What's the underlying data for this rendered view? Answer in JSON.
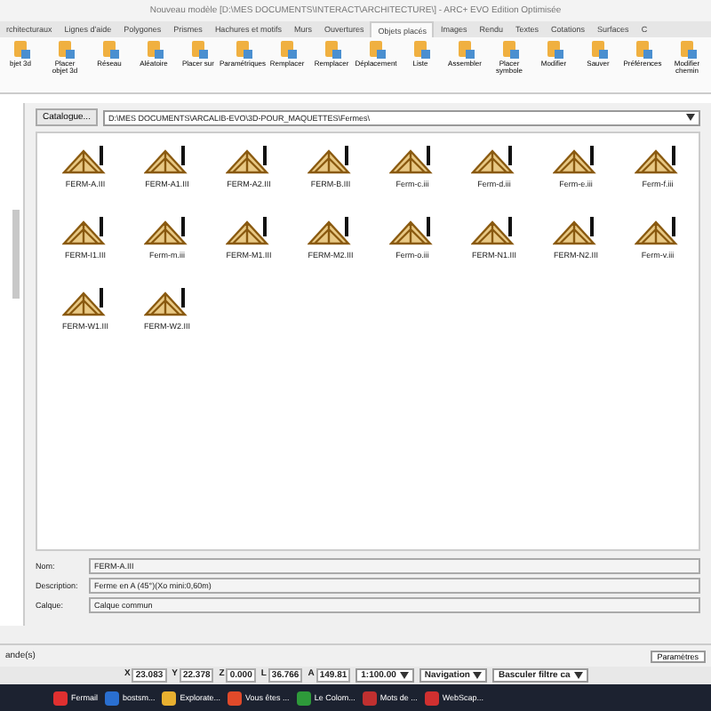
{
  "window": {
    "title": "Nouveau modèle [D:\\MES DOCUMENTS\\INTERACT\\ARCHITECTURE\\] - ARC+ EVO Edition Optimisée"
  },
  "ribbon_tabs": [
    {
      "label": "rchitecturaux",
      "selected": false
    },
    {
      "label": "Lignes d'aide",
      "selected": false
    },
    {
      "label": "Polygones",
      "selected": false
    },
    {
      "label": "Prismes",
      "selected": false
    },
    {
      "label": "Hachures et motifs",
      "selected": false
    },
    {
      "label": "Murs",
      "selected": false
    },
    {
      "label": "Ouvertures",
      "selected": false
    },
    {
      "label": "Objets placés",
      "selected": true
    },
    {
      "label": "Images",
      "selected": false
    },
    {
      "label": "Rendu",
      "selected": false
    },
    {
      "label": "Textes",
      "selected": false
    },
    {
      "label": "Cotations",
      "selected": false
    },
    {
      "label": "Surfaces",
      "selected": false
    },
    {
      "label": "C",
      "selected": false
    }
  ],
  "ribbon_buttons": [
    "bjet 3d",
    "Placer objet 3d",
    "Réseau",
    "Aléatoire",
    "Placer sur",
    "Paramétriques",
    "Remplacer",
    "Remplacer",
    "Déplacement",
    "Liste",
    "Assembler",
    "Placer symbole",
    "Modifier",
    "Sauver",
    "Préférences",
    "Modifier chemin"
  ],
  "catalogue_button": "Catalogue...",
  "path": "D:\\MES DOCUMENTS\\ARCALIB-EVO\\3D-POUR_MAQUETTES\\Fermes\\",
  "items": [
    "FERM-A.III",
    "FERM-A1.III",
    "FERM-A2.III",
    "FERM-B.III",
    "Ferm-c.iii",
    "Ferm-d.iii",
    "Ferm-e.iii",
    "Ferm-f.iii",
    "FERM-I1.III",
    "Ferm-m.iii",
    "FERM-M1.III",
    "FERM-M2.III",
    "Ferm-o.iii",
    "FERM-N1.III",
    "FERM-N2.III",
    "Ferm-v.iii",
    "FERM-W1.III",
    "FERM-W2.III"
  ],
  "fields": [
    {
      "label": "Nom:",
      "value": "FERM-A.III"
    },
    {
      "label": "Description:",
      "value": "Ferme en A (45°)(Xo mini:0,60m)"
    },
    {
      "label": "Calque:",
      "value": "Calque commun"
    }
  ],
  "status": {
    "left": "ande(s)",
    "button": "Paramètres"
  },
  "coords": [
    {
      "label": "X",
      "value": "23.083"
    },
    {
      "label": "Y",
      "value": "22.378"
    },
    {
      "label": "Z",
      "value": "0.000"
    },
    {
      "label": "L",
      "value": "36.766"
    },
    {
      "label": "A",
      "value": "149.81"
    }
  ],
  "dropdowns": [
    "1:100.00",
    "Navigation",
    "Basculer filtre ca"
  ],
  "taskbar": [
    "Fermail",
    "bostsm...",
    "Explorate...",
    "Vous êtes ...",
    "Le Colom...",
    "Mots de ...",
    "WebScap..."
  ]
}
